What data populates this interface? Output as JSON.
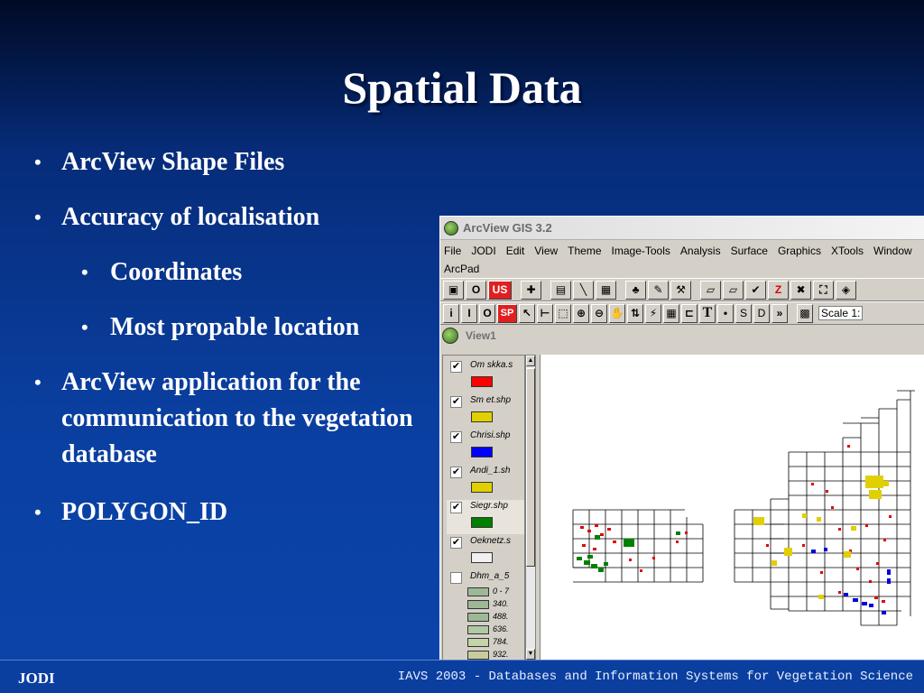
{
  "slide": {
    "title": "Spatial Data",
    "bullets": [
      {
        "text": "ArcView Shape Files",
        "level": 1
      },
      {
        "text": "Accuracy of localisation",
        "level": 1
      },
      {
        "text": "Coordinates",
        "level": 2
      },
      {
        "text": "Most propable location",
        "level": 2
      },
      {
        "text": "ArcView application for the communication to the vegetation database",
        "level": 1
      },
      {
        "text": "POLYGON_ID",
        "level": 1
      }
    ],
    "bullet_char": "•"
  },
  "window": {
    "title": "ArcView GIS 3.2",
    "menu": [
      "File",
      "JODI",
      "Edit",
      "View",
      "Theme",
      "Image-Tools",
      "Analysis",
      "Surface",
      "Graphics",
      "XTools",
      "Window",
      "ArcPad"
    ],
    "toolbar1": [
      "▣",
      "O",
      "US",
      "✚",
      "▤",
      "╲",
      "▦",
      "♣",
      "✎",
      "⚒",
      "▱",
      "▱",
      "✔",
      "Z",
      "✖",
      "⛶",
      "◈"
    ],
    "toolbar2": [
      "i",
      "I",
      "O",
      "SP",
      "↖",
      "⊢",
      "⬚",
      "⊕",
      "⊖",
      "✋",
      "⇅",
      "⚡",
      "▦",
      "⊏",
      "T",
      "•",
      "S",
      "D",
      "»",
      "▩"
    ],
    "scale_label": "Scale 1:",
    "view_title": "View1"
  },
  "themes": [
    {
      "name": "Om skka.s",
      "visible": true,
      "color": "#ff0000"
    },
    {
      "name": "Sm et.shp",
      "visible": true,
      "color": "#e0d000"
    },
    {
      "name": "Chrisi.shp",
      "visible": true,
      "color": "#0000ff"
    },
    {
      "name": "Andi_1.sh",
      "visible": true,
      "color": "#e0d000"
    },
    {
      "name": "Siegr.shp",
      "visible": true,
      "color": "#008000"
    },
    {
      "name": "Oeknetz.s",
      "visible": true,
      "color": "#f0f0f0"
    },
    {
      "name": "Dhm_a_5",
      "visible": false,
      "color": null
    }
  ],
  "legend_classes": [
    "0 - 7",
    "340.",
    "488.",
    "636.",
    "784.",
    "932."
  ],
  "footer": {
    "left": "JODI",
    "right": "IAVS 2003 - Databases and Information Systems for Vegetation Science"
  }
}
